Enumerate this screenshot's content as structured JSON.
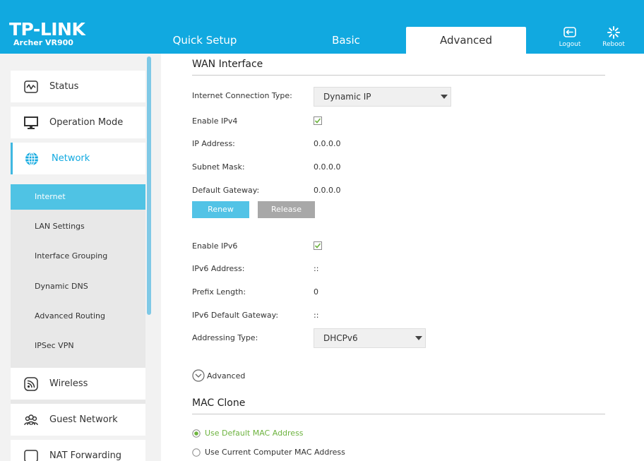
{
  "header": {
    "brand": "TP-LINK",
    "model": "Archer VR900",
    "tabs": [
      {
        "label": "Quick Setup",
        "active": false
      },
      {
        "label": "Basic",
        "active": false
      },
      {
        "label": "Advanced",
        "active": true
      }
    ],
    "logout_label": "Logout",
    "reboot_label": "Reboot",
    "color": "#11a9e0"
  },
  "sidebar": {
    "items": [
      {
        "label": "Status",
        "icon": "status-icon"
      },
      {
        "label": "Operation Mode",
        "icon": "monitor-icon"
      },
      {
        "label": "Network",
        "icon": "globe-icon",
        "active": true
      },
      {
        "label": "Wireless",
        "icon": "wireless-icon"
      },
      {
        "label": "Guest Network",
        "icon": "guest-network-icon"
      },
      {
        "label": "NAT Forwarding",
        "icon": "nat-forwarding-icon"
      }
    ],
    "submenu": [
      {
        "label": "Internet",
        "active": true
      },
      {
        "label": "LAN Settings"
      },
      {
        "label": "Interface Grouping"
      },
      {
        "label": "Dynamic DNS"
      },
      {
        "label": "Advanced Routing"
      },
      {
        "label": "IPSec VPN"
      }
    ]
  },
  "wan": {
    "title": "WAN Interface",
    "connection_type_label": "Internet Connection Type:",
    "connection_type_value": "Dynamic IP",
    "enable_ipv4_label": "Enable IPv4",
    "enable_ipv4_checked": true,
    "ip_address_label": "IP Address:",
    "ip_address_value": "0.0.0.0",
    "subnet_mask_label": "Subnet Mask:",
    "subnet_mask_value": "0.0.0.0",
    "default_gateway_label": "Default Gateway:",
    "default_gateway_value": "0.0.0.0",
    "renew_label": "Renew",
    "release_label": "Release",
    "enable_ipv6_label": "Enable IPv6",
    "enable_ipv6_checked": true,
    "ipv6_address_label": "IPv6 Address:",
    "ipv6_address_value": "::",
    "prefix_length_label": "Prefix Length:",
    "prefix_length_value": "0",
    "ipv6_gateway_label": "IPv6 Default Gateway:",
    "ipv6_gateway_value": "::",
    "addressing_type_label": "Addressing Type:",
    "addressing_type_value": "DHCPv6",
    "advanced_label": "Advanced"
  },
  "mac_clone": {
    "title": "MAC Clone",
    "options": [
      {
        "label": "Use Default MAC Address",
        "selected": true
      },
      {
        "label": "Use Current Computer MAC Address",
        "selected": false
      }
    ],
    "selected_color": "#6db33f"
  }
}
